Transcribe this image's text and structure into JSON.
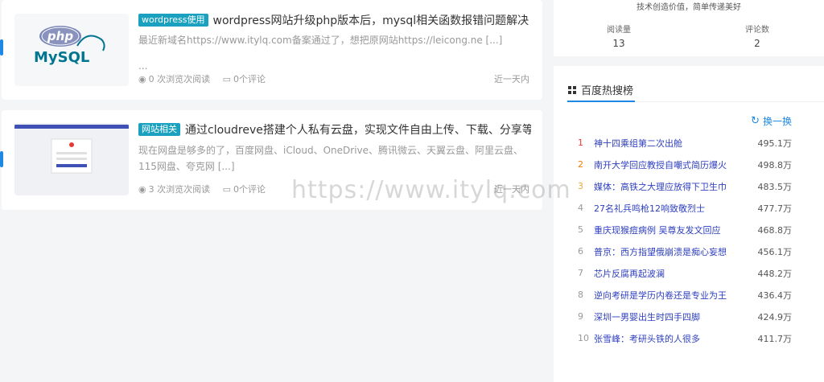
{
  "posts": [
    {
      "tag": "wordpress使用",
      "title": "wordpress网站升级php版本后，mysql相关函数报错问题解决",
      "excerpt": "最近新域名https://www.itylq.com备案通过了，想把原网站https://leicong.ne [...]",
      "excerpt2": "...",
      "views": "0 次浏览次阅读",
      "comments": "0个评论",
      "time": "近一天内",
      "thumb_text_php": "php",
      "thumb_text_mysql": "MySQL"
    },
    {
      "tag": "网站相关",
      "title": "通过cloudreve搭建个人私有云盘，实现文件自由上传、下载、分享等",
      "excerpt": "现在网盘是够多的了，百度网盘、iCloud、OneDrive、腾讯微云、天翼云盘、阿里云盘、115网盘、夸克网 [...]",
      "views": "3 次浏览次阅读",
      "comments": "0个评论",
      "time": "近一天内"
    }
  ],
  "profile": {
    "slogan": "技术创造价值，简单传递美好",
    "read_label": "阅读量",
    "read_value": "13",
    "comment_label": "评论数",
    "comment_value": "2"
  },
  "hot": {
    "title": "百度热搜榜",
    "refresh": "换一换",
    "items": [
      {
        "rank": "1",
        "title": "神十四乘组第二次出舱",
        "count": "495.1万"
      },
      {
        "rank": "2",
        "title": "南开大学回应教授自嘲式简历爆火",
        "count": "498.8万"
      },
      {
        "rank": "3",
        "title": "媒体：高铁之大理应放得下卫生巾",
        "count": "483.5万"
      },
      {
        "rank": "4",
        "title": "27名礼兵鸣枪12响致敬烈士",
        "count": "477.7万"
      },
      {
        "rank": "5",
        "title": "重庆现猴痘病例 吴尊友发文回应",
        "count": "468.8万"
      },
      {
        "rank": "6",
        "title": "普京：西方指望俄崩溃是痴心妄想",
        "count": "456.1万"
      },
      {
        "rank": "7",
        "title": "芯片反腐再起波澜",
        "count": "448.2万"
      },
      {
        "rank": "8",
        "title": "逆向考研是学历内卷还是专业为王",
        "count": "436.4万"
      },
      {
        "rank": "9",
        "title": "深圳一男婴出生时四手四脚",
        "count": "424.9万"
      },
      {
        "rank": "10",
        "title": "张雪峰：考研头铁的人很多",
        "count": "411.7万"
      }
    ]
  },
  "watermark": "https://www.itylq.com",
  "colors": {
    "accent": "#1e88e5",
    "tag": "#1ba1c0",
    "hot_link": "#2e3fbf"
  }
}
